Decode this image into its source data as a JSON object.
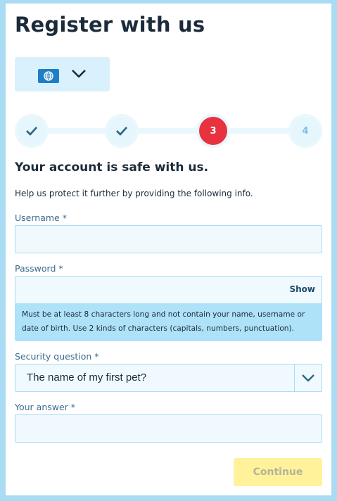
{
  "page": {
    "title": "Register with us",
    "heading": "Your account is safe with us.",
    "intro": "Help us protect it further by providing the following info."
  },
  "language": {
    "icon": "globe-icon",
    "caret": "chevron-down-icon"
  },
  "stepper": {
    "steps": [
      {
        "label": "",
        "state": "done",
        "icon": "checkmark-icon"
      },
      {
        "label": "",
        "state": "done",
        "icon": "checkmark-icon"
      },
      {
        "label": "3",
        "state": "current"
      },
      {
        "label": "4",
        "state": "upcoming"
      }
    ]
  },
  "form": {
    "username": {
      "label": "Username *",
      "value": ""
    },
    "password": {
      "label": "Password *",
      "value": "",
      "show_label": "Show",
      "hint": "Must be at least 8 characters long and not contain your name, username or date of birth. Use 2 kinds of characters (capitals, numbers, punctuation)."
    },
    "security_question": {
      "label": "Security question *",
      "selected": "The name of my first pet?"
    },
    "answer": {
      "label": "Your answer *",
      "value": ""
    },
    "continue_label": "Continue"
  },
  "colors": {
    "frame": "#a9dcf3",
    "field_bg": "#f0f9fe",
    "accent_red": "#e8323f",
    "button_disabled": "#fff29a",
    "icon_blue": "#1e7fc6"
  }
}
